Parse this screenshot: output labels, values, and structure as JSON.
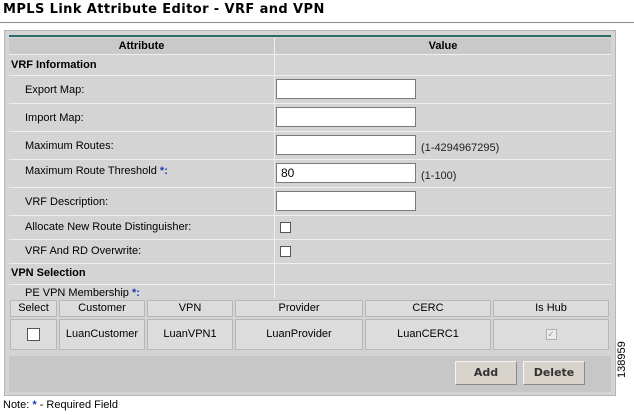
{
  "window": {
    "title": "MPLS Link Attribute Editor - VRF and VPN"
  },
  "table": {
    "headers": {
      "attribute": "Attribute",
      "value": "Value"
    }
  },
  "vrf_section": {
    "heading": "VRF Information",
    "export_map": {
      "label": "Export Map:",
      "value": ""
    },
    "import_map": {
      "label": "Import Map:",
      "value": ""
    },
    "max_routes": {
      "label": "Maximum Routes:",
      "value": "",
      "range": "(1-4294967295)"
    },
    "max_route_threshold": {
      "label": "Maximum Route Threshold",
      "required_mark": "*:",
      "value": "80",
      "range": "(1-100)"
    },
    "vrf_description": {
      "label": "VRF Description:",
      "value": ""
    },
    "allocate_rd": {
      "label": "Allocate New Route Distinguisher:",
      "checked": false
    },
    "vrf_rd_overwrite": {
      "label": "VRF And RD Overwrite:",
      "checked": false
    }
  },
  "vpn_section": {
    "heading": "VPN Selection",
    "pe_vpn_membership": {
      "label": "PE VPN Membership",
      "required_mark": "*:"
    }
  },
  "vpn_table": {
    "columns": [
      "Select",
      "Customer",
      "VPN",
      "Provider",
      "CERC",
      "Is Hub"
    ],
    "rows": [
      {
        "selected": false,
        "customer": "LuanCustomer",
        "vpn": "LuanVPN1",
        "provider": "LuanProvider",
        "cerc": "LuanCERC1",
        "is_hub": true
      }
    ]
  },
  "buttons": {
    "add": "Add",
    "delete": "Delete"
  },
  "footer": {
    "note_prefix": "Note:",
    "star": "*",
    "note_suffix": "- Required Field"
  },
  "figure_id": "138959",
  "colors": {
    "accent_line": "#2e6a6a",
    "required_star": "#1a3fb5",
    "panel": "#d4d4d4"
  }
}
